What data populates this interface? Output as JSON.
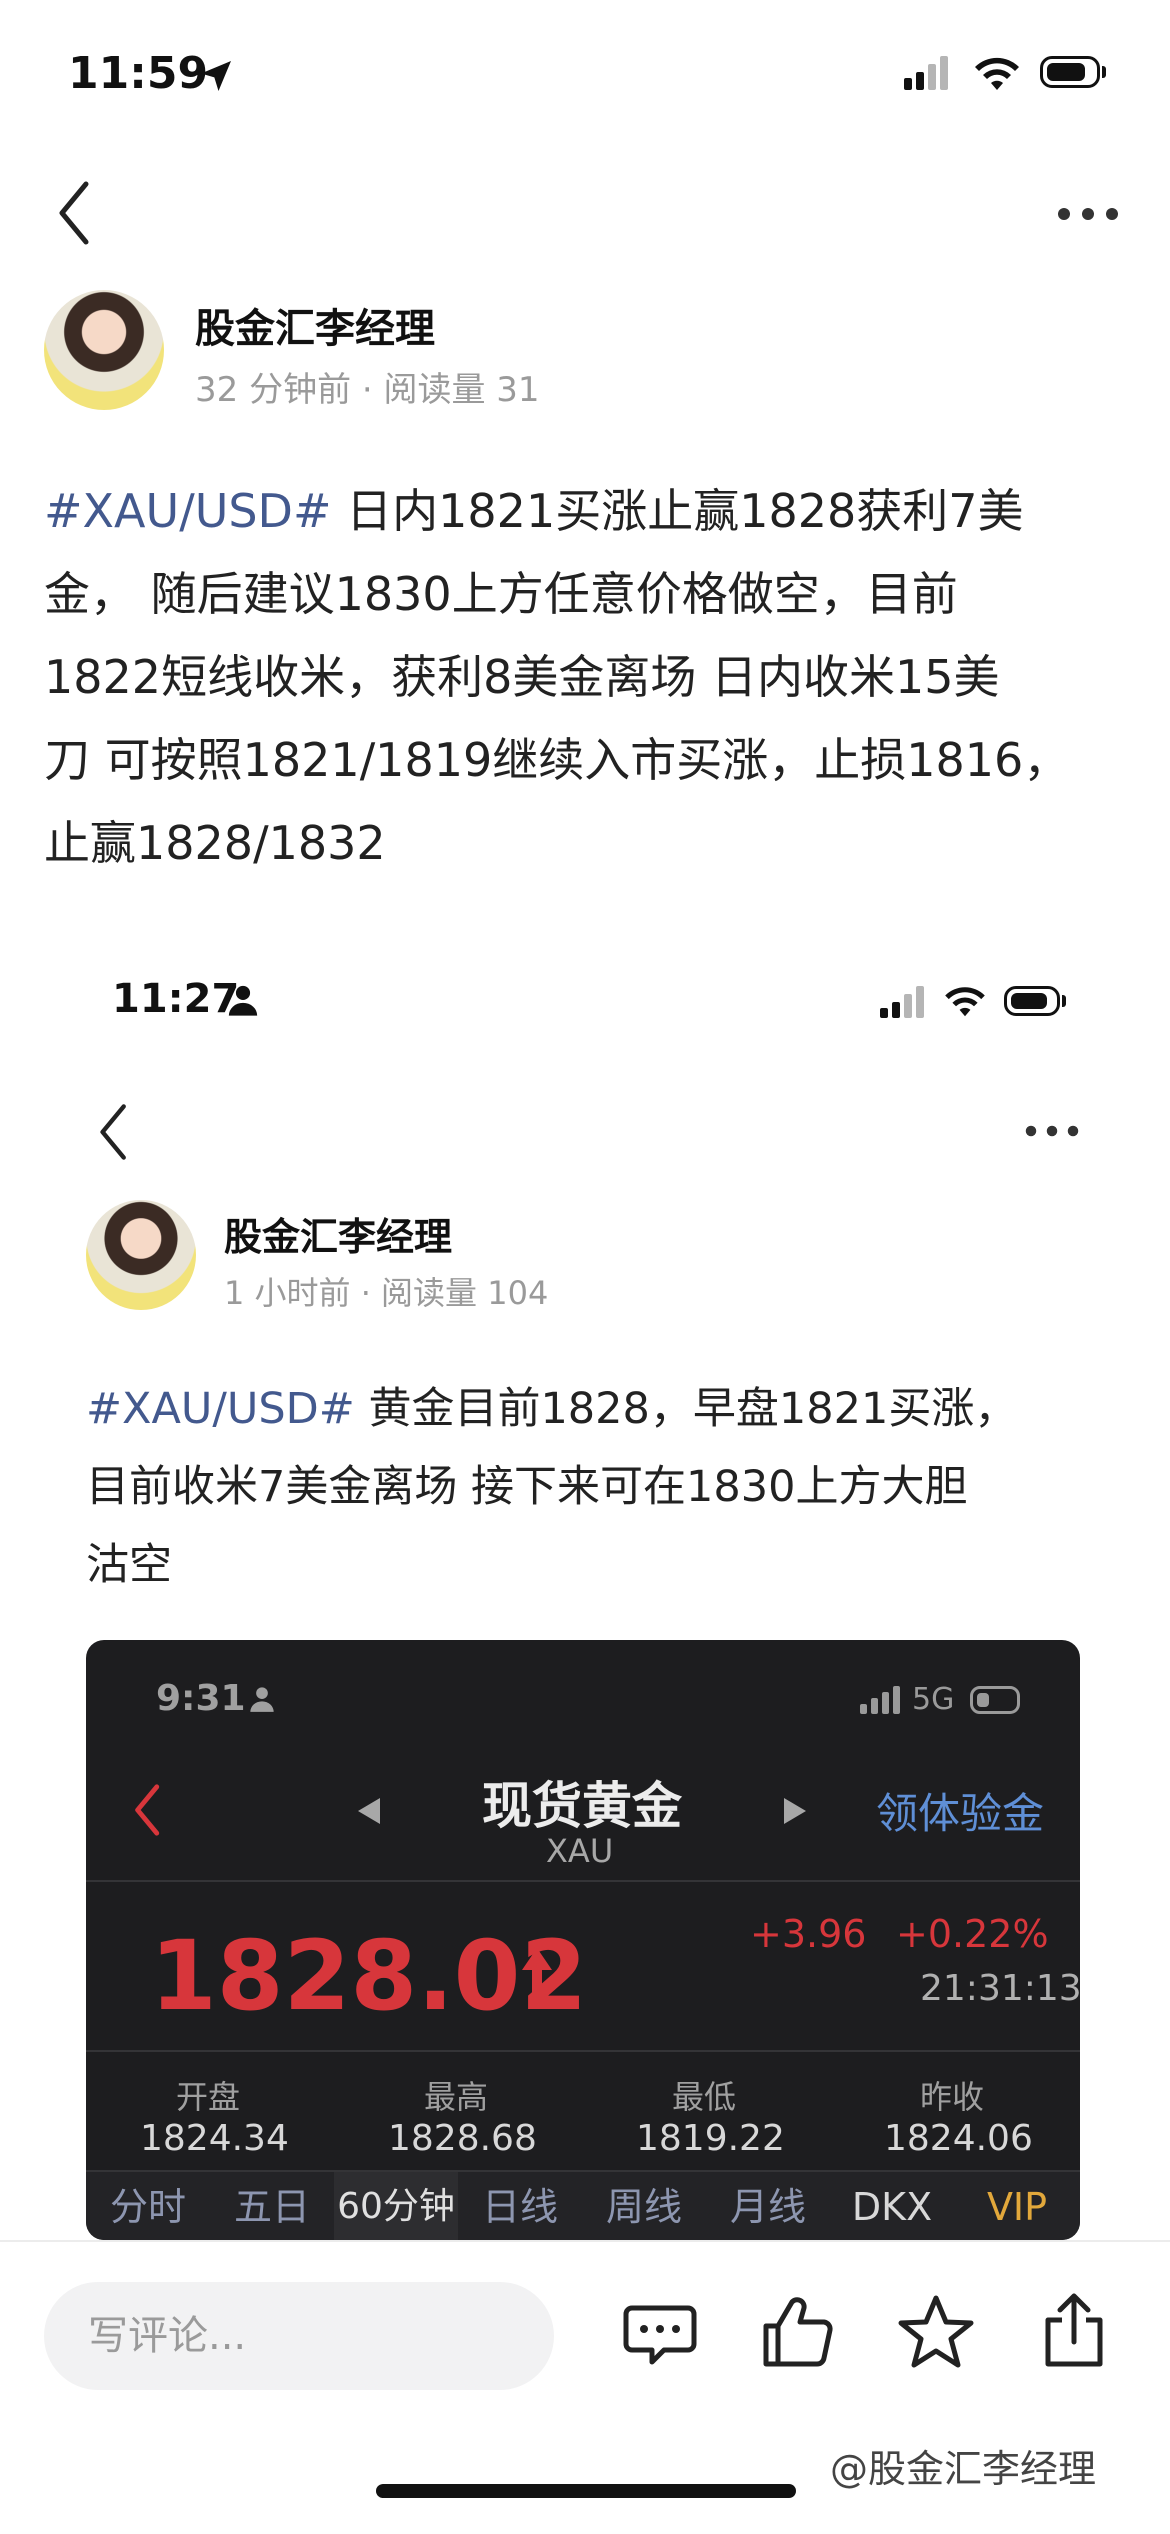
{
  "status_bar_top": {
    "time": "11:59"
  },
  "post_top": {
    "author": "股金汇李经理",
    "meta": "32 分钟前 · 阅读量 31",
    "hashtag": "#XAU/USD#",
    "lines": [
      " 日内1821买涨止赢1828获利7美",
      "金， 随后建议1830上方任意价格做空，目前",
      "1822短线收米，获利8美金离场 日内收米15美",
      "刀 可按照1821/1819继续入市买涨，止损1816，",
      "止赢1828/1832"
    ]
  },
  "status_bar_inner": {
    "time": "11:27"
  },
  "post_inner": {
    "author": "股金汇李经理",
    "meta": "1 小时前 · 阅读量 104",
    "hashtag": "#XAU/USD#",
    "lines": [
      " 黄金目前1828，早盘1821买涨，",
      "目前收米7美金离场 接下来可在1830上方大胆",
      "沽空"
    ]
  },
  "quote_screen": {
    "time": "9:31",
    "network": "5G",
    "title": "现货黄金",
    "subtitle": "XAU",
    "right_link": "领体验金",
    "price": "1828.02",
    "change": "+3.96",
    "change_pct": "+0.22%",
    "timestamp": "21:31:13",
    "stats": [
      {
        "label": "开盘",
        "value": "1824.34"
      },
      {
        "label": "最高",
        "value": "1828.68"
      },
      {
        "label": "最低",
        "value": "1819.22"
      },
      {
        "label": "昨收",
        "value": "1824.06"
      }
    ],
    "tabs": [
      "分时",
      "五日",
      "60分钟",
      "日线",
      "周线",
      "月线",
      "DKX",
      "VIP"
    ],
    "active_tab": "60分钟"
  },
  "bottom_bar": {
    "comment_placeholder": "写评论...",
    "watermark": "@股金汇李经理"
  },
  "icons": [
    "back-icon",
    "more-icon",
    "location-arrow-icon",
    "person-icon",
    "comment-icon",
    "thumbs-up-icon",
    "star-icon",
    "share-icon"
  ]
}
